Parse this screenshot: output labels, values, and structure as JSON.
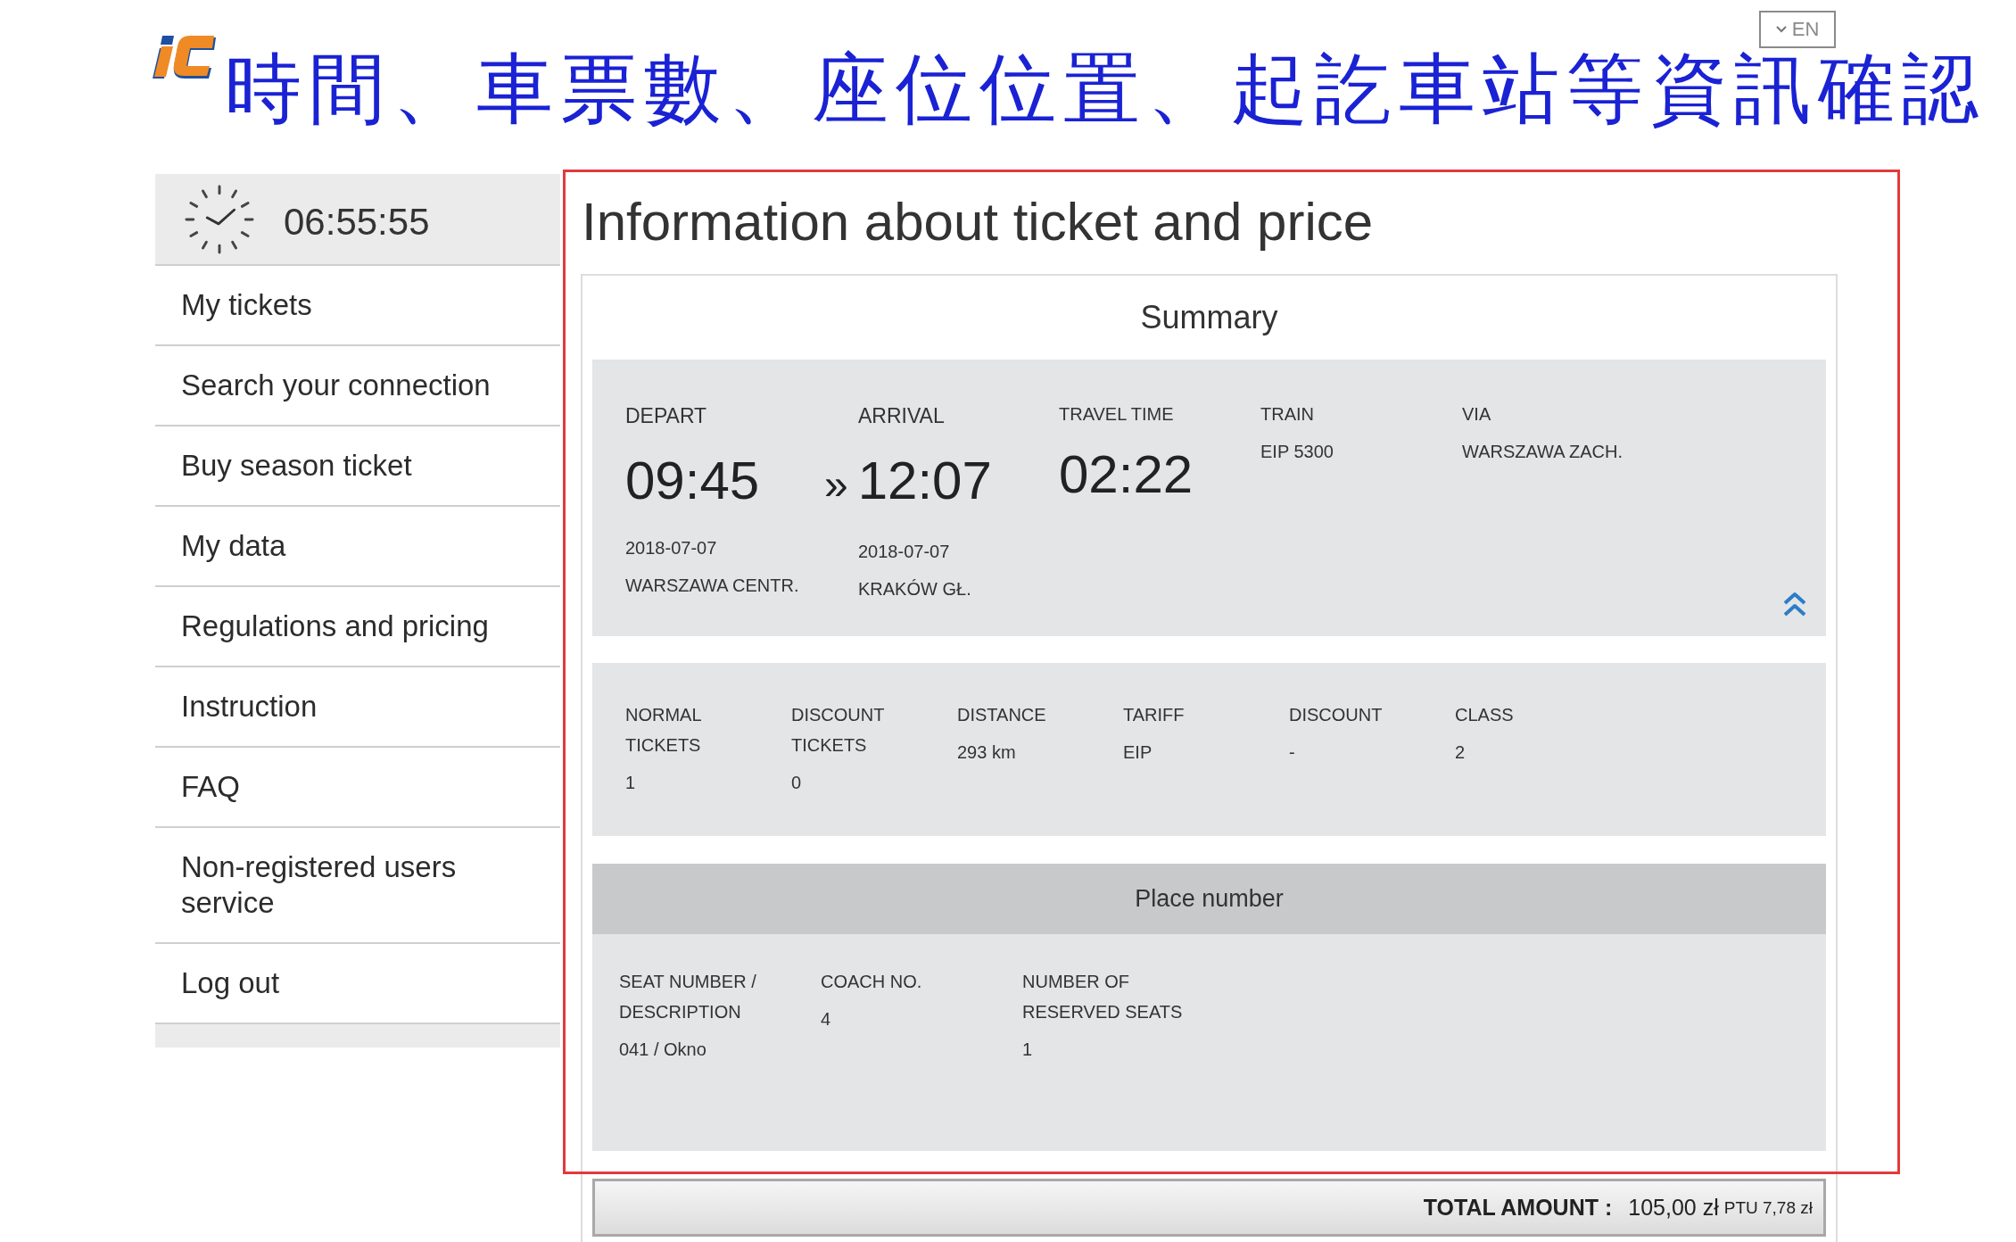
{
  "annotation": {
    "caption": "時間、車票數、座位位置、起訖車站等資訊確認"
  },
  "header": {
    "language": "EN"
  },
  "sidebar": {
    "clock": "06:55:55",
    "items": [
      {
        "label": "My tickets"
      },
      {
        "label": "Search your connection"
      },
      {
        "label": "Buy season ticket"
      },
      {
        "label": "My data"
      },
      {
        "label": "Regulations and pricing"
      },
      {
        "label": "Instruction"
      },
      {
        "label": "FAQ"
      },
      {
        "label": "Non-registered users service"
      },
      {
        "label": "Log out"
      }
    ]
  },
  "main": {
    "title": "Information about ticket and price"
  },
  "summary": {
    "title": "Summary",
    "journey": {
      "expanded": true,
      "depart": {
        "label": "DEPART",
        "time": "09:45",
        "date": "2018-07-07",
        "station": "WARSZAWA CENTR."
      },
      "arrival": {
        "label": "ARRIVAL",
        "separator": "»",
        "time": "12:07",
        "date": "2018-07-07",
        "station": "KRAKÓW GŁ."
      },
      "travel_time": {
        "label": "TRAVEL TIME",
        "value": "02:22"
      },
      "train": {
        "label": "TRAIN",
        "value": "EIP 5300"
      },
      "via": {
        "label": "VIA",
        "value": "WARSZAWA ZACH."
      }
    },
    "tickets": [
      {
        "label": "NORMAL TICKETS",
        "value": "1"
      },
      {
        "label": "DISCOUNT TICKETS",
        "value": "0"
      },
      {
        "label": "DISTANCE",
        "value": "293 km"
      },
      {
        "label": "TARIFF",
        "value": "EIP"
      },
      {
        "label": "DISCOUNT",
        "value": "-"
      },
      {
        "label": "CLASS",
        "value": "2"
      }
    ],
    "place": {
      "title": "Place number",
      "fields": [
        {
          "label": "SEAT NUMBER / DESCRIPTION",
          "value": "041 / Okno"
        },
        {
          "label": "COACH NO.",
          "value": "4"
        },
        {
          "label": "NUMBER OF RESERVED SEATS",
          "value": "1"
        }
      ]
    },
    "total": {
      "label": "TOTAL AMOUNT :",
      "amount": "105,00 zł",
      "tax": "PTU 7,78 zł"
    }
  }
}
